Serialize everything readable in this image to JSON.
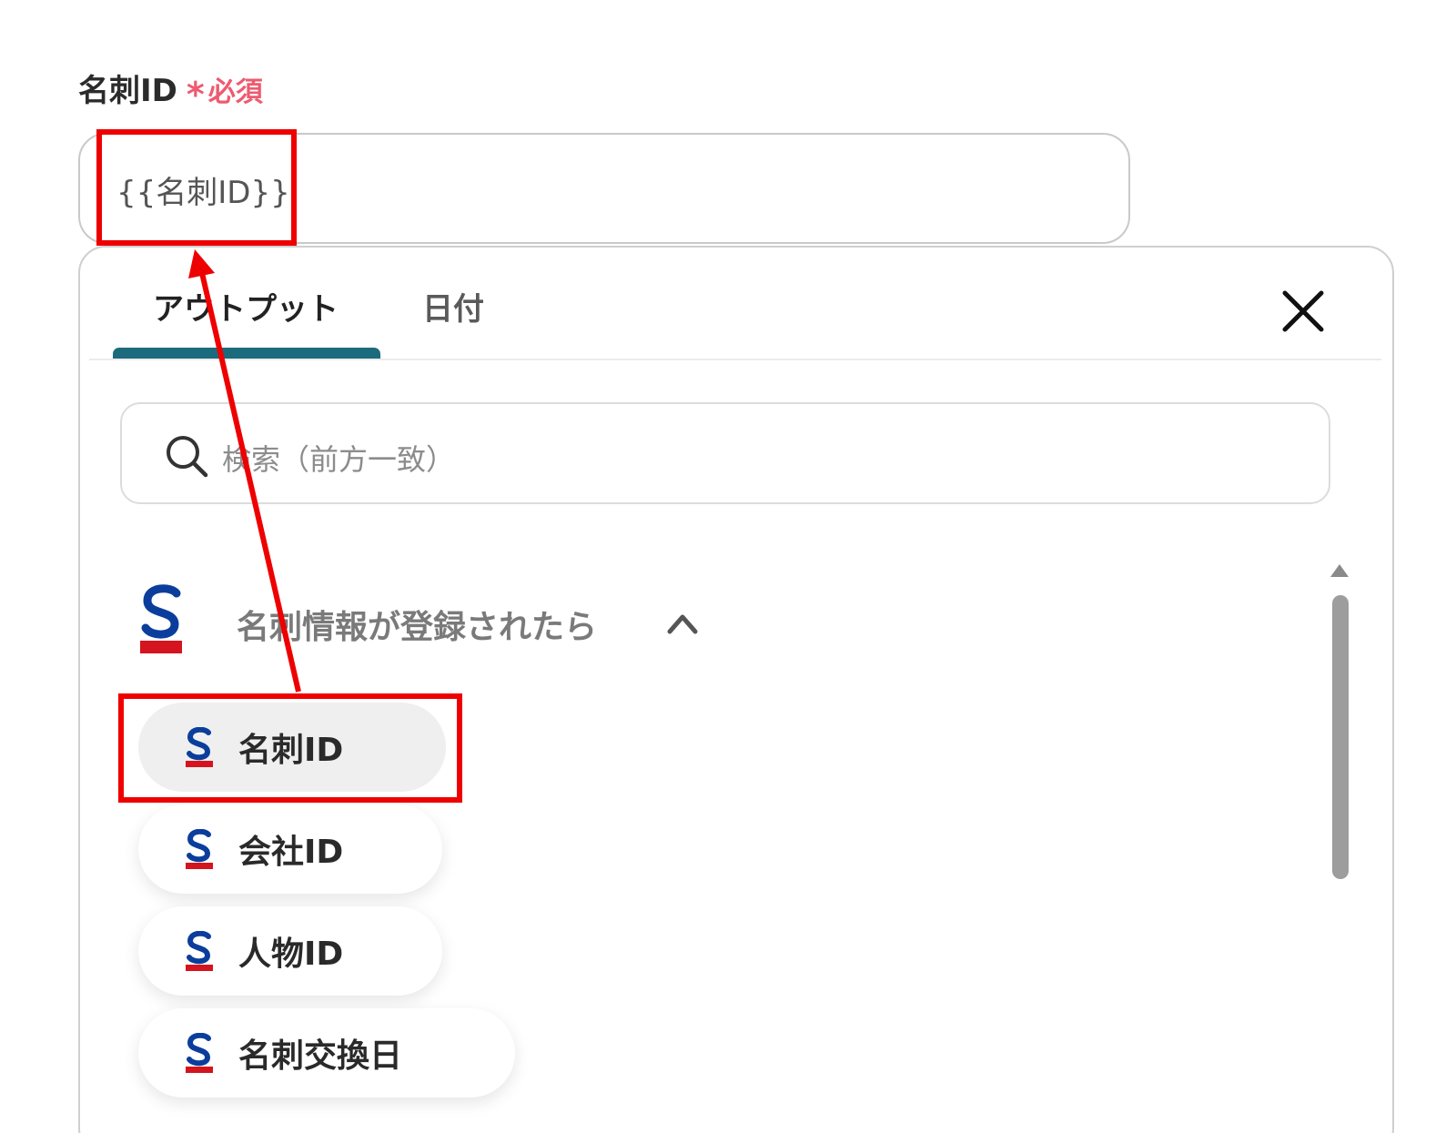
{
  "field": {
    "label": "名刺ID",
    "required_star": "*",
    "required_text": "必須",
    "value": "{{名刺ID}}"
  },
  "picker": {
    "tabs": [
      {
        "label": "アウトプット",
        "active": true
      },
      {
        "label": "日付",
        "active": false
      }
    ],
    "close_icon": "close-icon",
    "search": {
      "placeholder": "検索（前方一致）",
      "icon": "search-icon"
    },
    "group": {
      "title": "名刺情報が登録されたら",
      "logo_icon": "sansan-logo-icon",
      "expanded": true,
      "items": [
        {
          "label": "名刺ID",
          "selected": true
        },
        {
          "label": "会社ID",
          "selected": false
        },
        {
          "label": "人物ID",
          "selected": false
        },
        {
          "label": "名刺交換日",
          "selected": false
        }
      ]
    }
  },
  "colors": {
    "required": "#ee5a6f",
    "tab_indicator": "#1c6b7d",
    "annotation": "#ee0000",
    "logo_blue": "#0b3e9c",
    "logo_red": "#d4141e"
  }
}
